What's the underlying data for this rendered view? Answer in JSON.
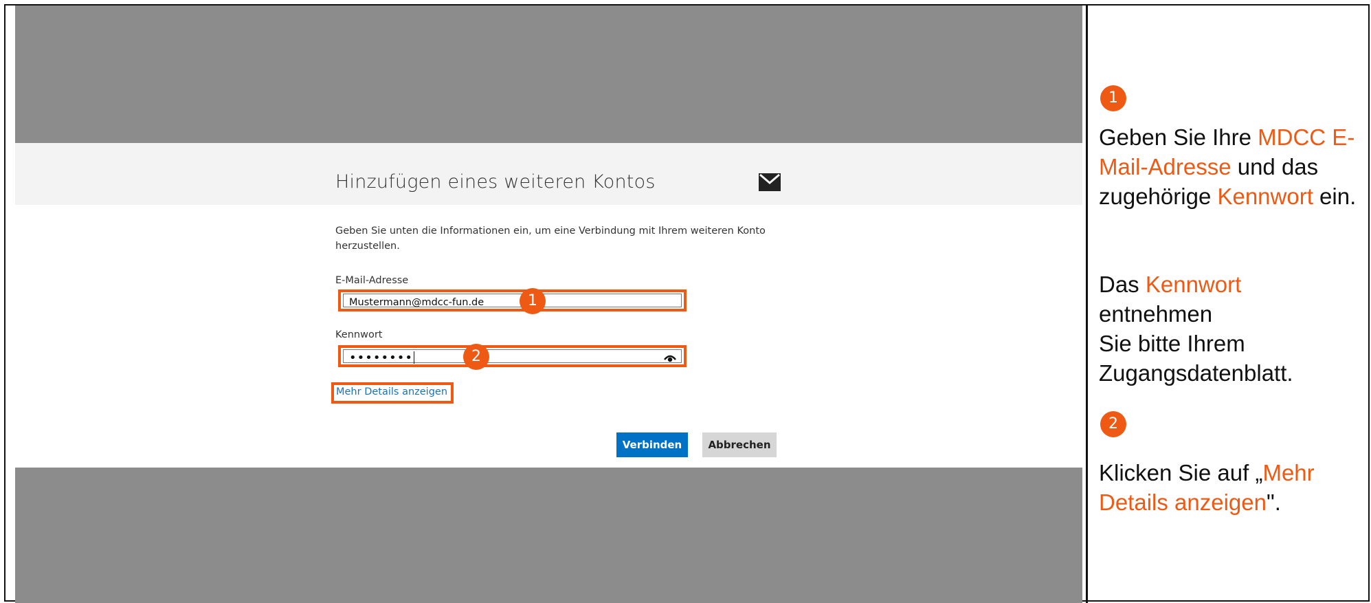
{
  "dialog": {
    "title": "Hinzufügen eines weiteren Kontos",
    "instruction": "Geben Sie unten die Informationen ein, um eine Verbindung mit Ihrem weiteren Konto herzustellen.",
    "email_label": "E-Mail-Adresse",
    "email_value": "Mustermann@mdcc-fun.de",
    "password_label": "Kennwort",
    "password_dots": "••••••••",
    "details_link": "Mehr Details anzeigen",
    "connect_button": "Verbinden",
    "cancel_button": "Abbrechen",
    "icons": {
      "mail": "envelope-icon",
      "show_password": "eye-icon"
    }
  },
  "markers": {
    "one": "1",
    "two": "2"
  },
  "side_panel": {
    "step1_marker": "1",
    "step1_a": "Geben Sie Ihre ",
    "step1_b": "MDCC E-Mail-Adresse",
    "step1_c": " und das zugehörige ",
    "step1_d": "Kennwort",
    "step1_e": " ein.",
    "step1_f": "Das ",
    "step1_g": "Kennwort",
    "step1_h": " entnehmen",
    "step1_i": "Sie bitte Ihrem Zugangsdatenblatt.",
    "step2_marker": "2",
    "step2_a": "Klicken Sie auf „",
    "step2_b": "Mehr Details anzeigen",
    "step2_c": "\"."
  },
  "colors": {
    "accent": "#ee5a13",
    "primary_button": "#0072c6",
    "link": "#1a73b6",
    "overlay": "#8c8c8c"
  }
}
